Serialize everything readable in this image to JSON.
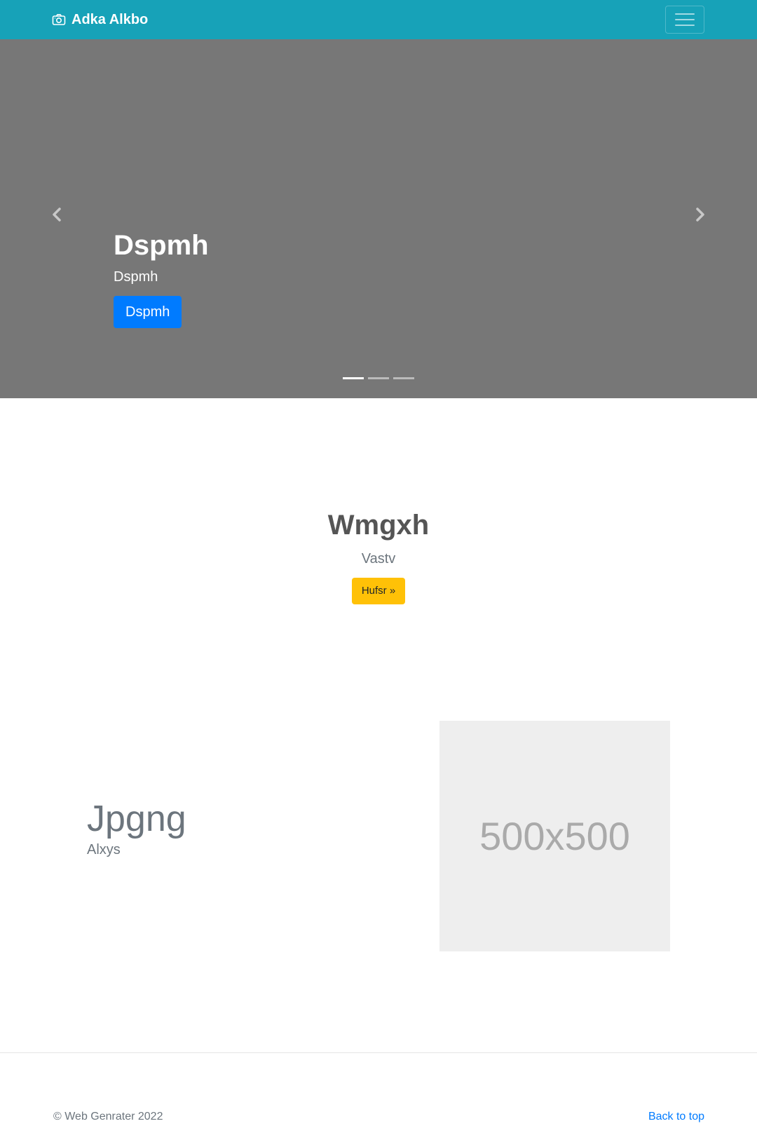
{
  "navbar": {
    "brand": "Adka Alkbo",
    "brand_icon": "camera-icon",
    "toggler_icon": "hamburger-menu-icon",
    "background": "#17a2b8"
  },
  "carousel": {
    "title": "Dspmh",
    "subtitle": "Dspmh",
    "button_label": "Dspmh",
    "slide_count": 3,
    "active_slide": 1,
    "prev_icon": "chevron-left-icon",
    "next_icon": "chevron-right-icon",
    "background": "#777777"
  },
  "jumbotron": {
    "title": "Wmgxh",
    "subtitle": "Vastv",
    "button_label": "Hufsr »"
  },
  "feature": {
    "heading": "Jpgng",
    "subheading": "Alxys",
    "image_placeholder": "500x500"
  },
  "footer": {
    "copyright": "© Web Genrater 2022",
    "back_to_top": "Back to top"
  },
  "colors": {
    "primary": "#007bff",
    "warning": "#ffc107",
    "info": "#17a2b8",
    "muted": "#6c757d"
  }
}
